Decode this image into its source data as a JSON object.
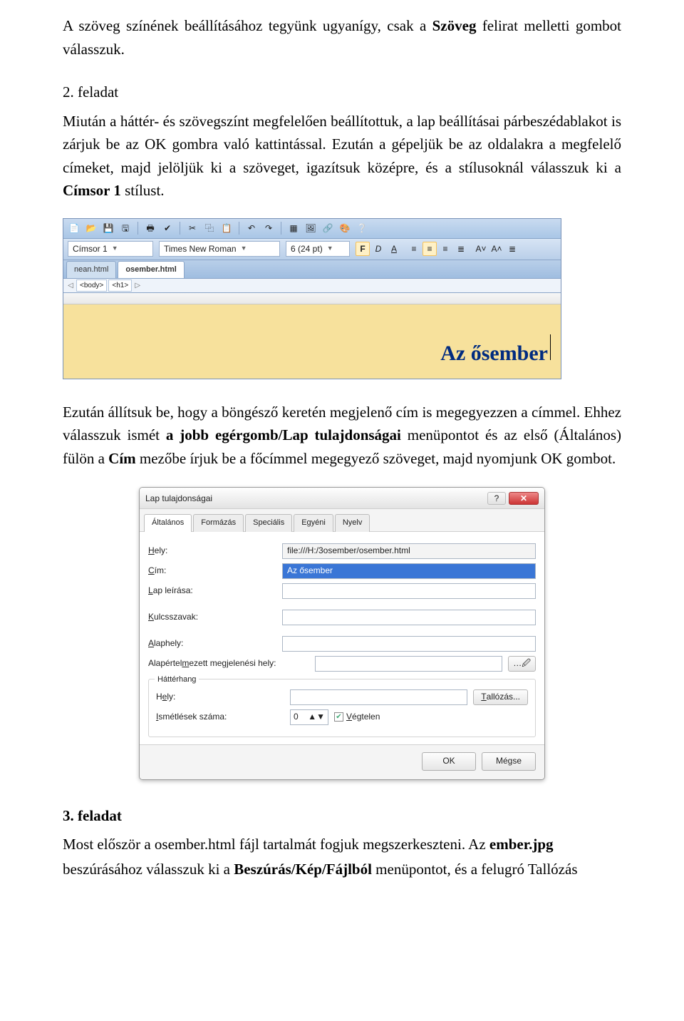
{
  "para1_a": "A szöveg színének beállításához tegyünk ugyanígy, csak a ",
  "para1_b": "Szöveg",
  "para1_c": " felirat melletti gombot válasszuk.",
  "h2_task2": "2. feladat",
  "para2": "Miután a háttér- és szövegszínt megfelelően beállítottuk, a lap beállításai párbeszédablakot is zárjuk be az OK gombra való kattintással. Ezután a gépeljük be az oldalakra a megfelelő címeket, majd jelöljük ki a szöveget, igazítsuk középre, és a stílusoknál válasszuk ki a ",
  "para2_bold": "Címsor 1",
  "para2_end": " stílust.",
  "fig1": {
    "style_field": "Címsor 1",
    "font_field": "Times New Roman",
    "size_field": "6 (24 pt)",
    "bold": "F",
    "italic": "D",
    "underline": "A",
    "tabs": {
      "inactive": "nean.html",
      "active": "osember.html"
    },
    "crumb_left": "◁",
    "crumb_body": "<body>",
    "crumb_h1": "<h1>",
    "crumb_right": "▷",
    "headline": "Az ősember"
  },
  "para3_a": "Ezután állítsuk be, hogy a böngésző keretén megjelenő cím is megegyezzen a címmel. Ehhez válasszuk ismét ",
  "para3_bold1": "a jobb egérgomb/Lap tulajdonságai",
  "para3_mid": " menüpontot és az első (Általános) fülön a ",
  "para3_bold2": "Cím",
  "para3_end": " mezőbe írjuk be a főcímmel megegyező szöveget, majd nyomjunk OK gombot.",
  "fig2": {
    "title": "Lap tulajdonságai",
    "help": "?",
    "close": "✕",
    "tabs": [
      "Általános",
      "Formázás",
      "Speciális",
      "Egyéni",
      "Nyelv"
    ],
    "labels": {
      "hely": "Hely:",
      "cim": "Cím:",
      "lap": "Lap leírása:",
      "kulcs": "Kulcsszavak:",
      "alap": "Alaphely:",
      "alapm": "Alapértelmezett megjelenési hely:",
      "grp": "Háttérhang",
      "hely2": "Hely:",
      "ism": "Ismétlések száma:"
    },
    "values": {
      "hely_path": "file:///H:/3osember/osember.html",
      "cim_value": "Az ősember",
      "spinner": "0",
      "vegtelen": "Végtelen",
      "browse": "Tallózás...",
      "browse_ico": "…🖉"
    },
    "buttons": {
      "ok": "OK",
      "cancel": "Mégse"
    }
  },
  "h2_task3": "3. feladat",
  "para4_a": "Most először a osember.html fájl tartalmát fogjuk megszerkeszteni. Az ",
  "para4_bold": "ember.jpg",
  "para5_a": "beszúrásához válasszuk ki a ",
  "para5_bold": "Beszúrás/Kép/Fájlból",
  "para5_end": " menüpontot, és a felugró Tallózás"
}
